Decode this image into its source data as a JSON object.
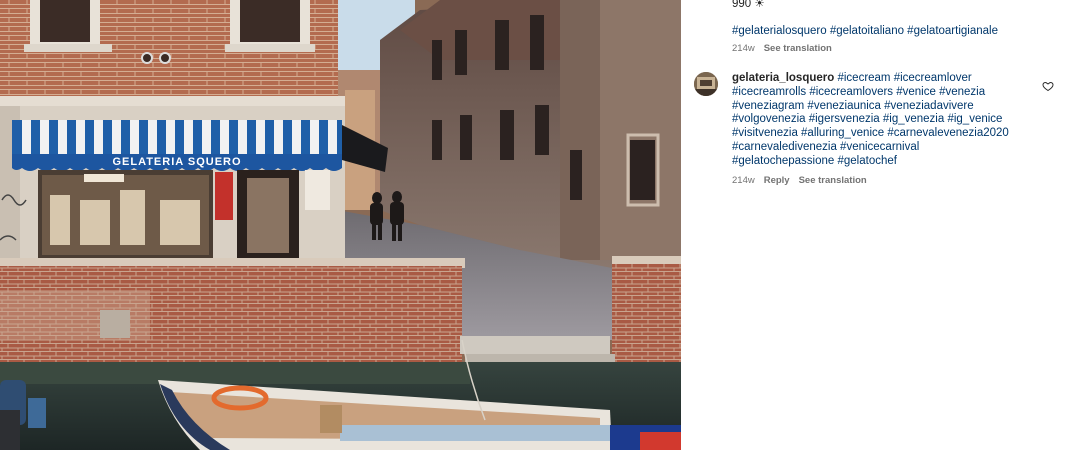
{
  "post": {
    "like_count": "990 ☀",
    "caption_hashtags": "#gelaterialosquero #gelatoitaliano #gelatoartigianale",
    "caption_age": "214w",
    "see_translation": "See translation"
  },
  "comment": {
    "username": "gelateria_losquero",
    "text": "#icecream #icecreamlover #icecreamrolls #icecreamlovers #venice #venezia #veneziagram #veneziaunica #veneziadavivere #volgovenezia #igersvenezia #ig_venezia #ig_venice #visitvenezia #alluring_venice #carnevalevenezia2020 #carnevaledivenezia #venicecarnival #gelatochepassione #gelatochef",
    "age": "214w",
    "reply": "Reply",
    "see_translation": "See translation",
    "like_icon": "heart-icon"
  },
  "photo": {
    "shop_sign": "GELATERIA SQUERO",
    "colors": {
      "awning_blue": "#1f5fa8",
      "brick": "#a5553f",
      "sky": "#c9dcea",
      "water": "#2c3a3a"
    }
  }
}
